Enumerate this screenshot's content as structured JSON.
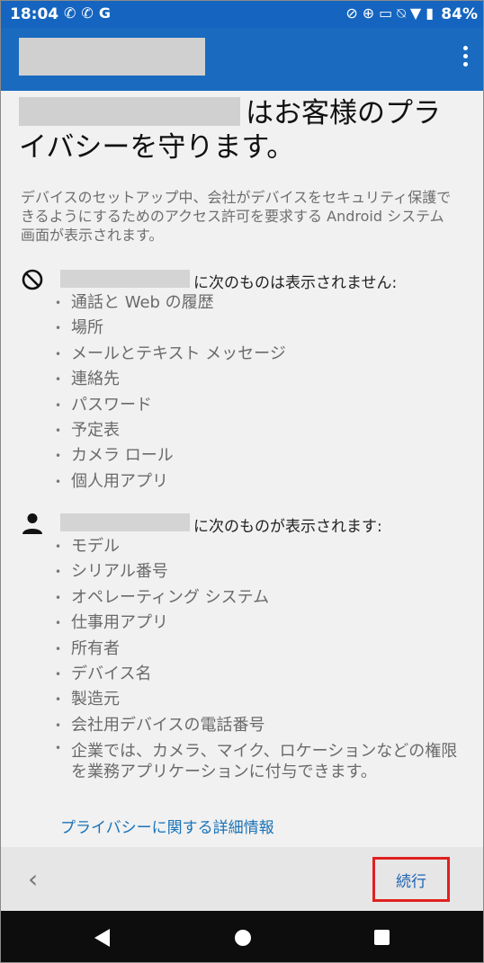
{
  "status_bar": {
    "time": "18:04",
    "left_icons": [
      "phone-icon",
      "phone-icon",
      "google-icon"
    ],
    "right_icons": [
      "nfc-icon",
      "data-saver-icon",
      "cast-icon",
      "notifications-off-icon",
      "wifi-icon",
      "battery-icon"
    ],
    "battery": "84%"
  },
  "header": {
    "menu_icon": "more-vert-icon"
  },
  "heading": {
    "suffix_line1": "はお客様のプラ",
    "line2": "イバシーを守ります。"
  },
  "intro": "デバイスのセットアップ中、会社がデバイスをセキュリティ保護できるようにするためのアクセス許可を要求する Android システム画面が表示されます。",
  "cannot_see": {
    "icon": "block-icon",
    "label": "に次のものは表示されません:",
    "items": [
      "通話と Web の履歴",
      "場所",
      "メールとテキスト メッセージ",
      "連絡先",
      "パスワード",
      "予定表",
      "カメラ ロール",
      "個人用アプリ"
    ]
  },
  "can_see": {
    "icon": "person-icon",
    "label": "に次のものが表示されます:",
    "items": [
      "モデル",
      "シリアル番号",
      "オペレーティング システム",
      "仕事用アプリ",
      "所有者",
      "デバイス名",
      "製造元",
      "会社用デバイスの電話番号",
      "企業では、カメラ、マイク、ロケーションなどの権限を業務アプリケーションに付与できます。"
    ]
  },
  "more_info_link": "プライバシーに関する詳細情報",
  "footer": {
    "back_icon": "chevron-left-icon",
    "next_label": "続行"
  },
  "nav": {
    "back": "nav-back-icon",
    "home": "nav-home-icon",
    "recents": "nav-recents-icon"
  }
}
